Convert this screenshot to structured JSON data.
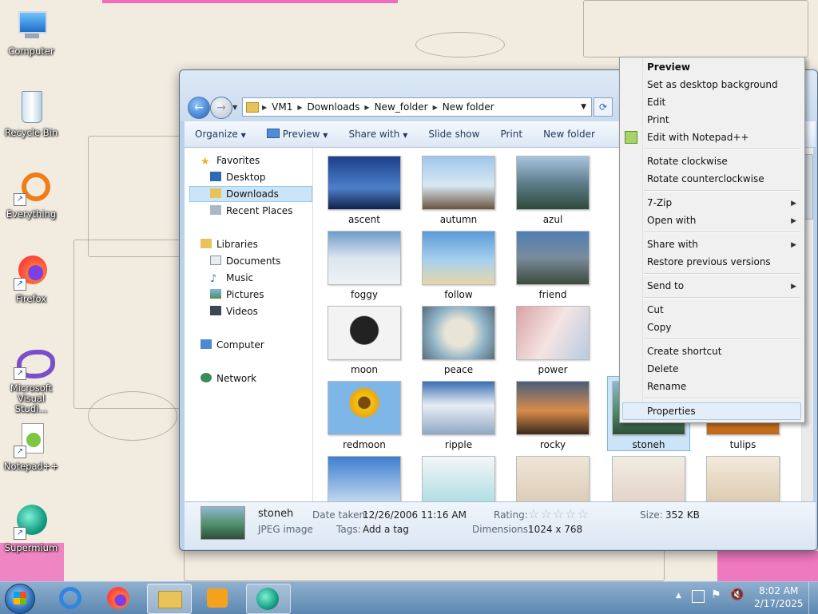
{
  "desktop_icons": [
    {
      "label": "Computer",
      "icon": "computer-icon"
    },
    {
      "label": "Recycle Bin",
      "icon": "recycle-bin-icon"
    },
    {
      "label": "Everything",
      "icon": "everything-icon"
    },
    {
      "label": "Firefox",
      "icon": "firefox-icon"
    },
    {
      "label": "Microsoft Visual Studi...",
      "icon": "visual-studio-icon"
    },
    {
      "label": "Notepad++",
      "icon": "notepadpp-icon"
    },
    {
      "label": "Supermium",
      "icon": "supermium-icon"
    }
  ],
  "explorer": {
    "breadcrumb": [
      "VM1",
      "Downloads",
      "New_folder",
      "New folder"
    ],
    "toolbar": [
      "Organize",
      "Preview",
      "Share with",
      "Slide show",
      "Print",
      "New folder"
    ],
    "nav": {
      "favorites": "Favorites",
      "desktop": "Desktop",
      "downloads": "Downloads",
      "recent": "Recent Places",
      "libraries": "Libraries",
      "documents": "Documents",
      "music": "Music",
      "pictures": "Pictures",
      "videos": "Videos",
      "computer": "Computer",
      "network": "Network"
    },
    "thumbs": [
      "ascent",
      "autumn",
      "azul",
      "foggy",
      "follow",
      "friend",
      "moon",
      "peace",
      "power",
      "redmoon",
      "ripple",
      "rocky",
      "stoneh",
      "tulips"
    ],
    "details": {
      "name": "stoneh",
      "type": "JPEG image",
      "date_key": "Date taken:",
      "date_val": "12/26/2006 11:16 AM",
      "tags_key": "Tags:",
      "tags_val": "Add a tag",
      "rating_key": "Rating:",
      "dim_key": "Dimensions:",
      "dim_val": "1024 x 768",
      "size_key": "Size:",
      "size_val": "352 KB"
    }
  },
  "context_menu": {
    "preview": "Preview",
    "set_bg": "Set as desktop background",
    "edit": "Edit",
    "print": "Print",
    "notepad": "Edit with Notepad++",
    "rot_cw": "Rotate clockwise",
    "rot_ccw": "Rotate counterclockwise",
    "zip": "7-Zip",
    "open_with": "Open with",
    "share_with": "Share with",
    "restore": "Restore previous versions",
    "send_to": "Send to",
    "cut": "Cut",
    "copy": "Copy",
    "shortcut": "Create shortcut",
    "delete": "Delete",
    "rename": "Rename",
    "properties": "Properties"
  },
  "taskbar": {
    "time": "8:02 AM",
    "date": "2/17/2025"
  },
  "colors": {
    "selection": "#cce4f7",
    "taskbar": "#6f97bd",
    "accent_pink": "#f06bbb"
  }
}
